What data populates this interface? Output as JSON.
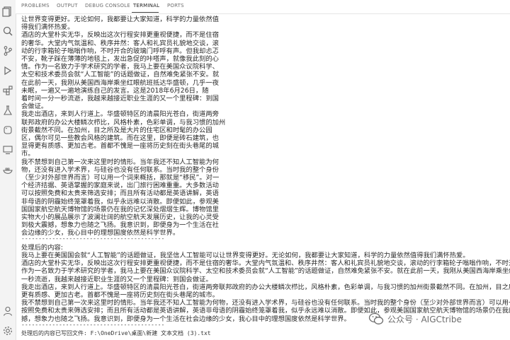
{
  "tabs": [
    {
      "label": "PROBLEMS"
    },
    {
      "label": "OUTPUT"
    },
    {
      "label": "DEBUG CONSOLE"
    },
    {
      "label": "TERMINAL"
    },
    {
      "label": "PORTS"
    }
  ],
  "narrow_lines": [
    "让世界变得更好。无论如何，我都要让大家知道，科学的力量依然值",
    "得我们满怀热爱。",
    "酒店的大堂朴实无华，反映出这次行程安排更重视便捷，而不是住宿",
    "的奢华。大堂内气氛温和、秩序井然：客人和礼宾员礼貌地交谈，滚",
    "动的行李箱轮子嗡嗡作响，不时开合的玻璃门呼呼有声。但我却忐忑",
    "不安，靴子踩在薄薄的地毯上，发出急促的咔嗒声，就像我此刻的心",
    "情。作为一名致力于学术研究的学者，我马上要在美国众议院科学、",
    "太空和技术委员会就“人工智能”的话题做证，自然难免紧张不安。就",
    "在此前一天，我刚从美国西海岸乘坐红眼航班抵达华盛顿，几乎一夜",
    "未眠，一遍又一遍地演练自己的发言。这是2018年6月26日，随",
    "着时间一分一秒流逝，我越来越接近职业生涯的又一个里程碑：到国",
    "会做证。",
    "我走出酒店，来到人行道上。华盛顿特区的清晨阳光苍白，街道两旁",
    "联邦政府的办公大楼鳞次栉比，风格朴素，色彩单调，与我习惯的加州",
    "街景截然不同。在加州，目之所及是大片的住宅区和时髦的办公园",
    "区，偶尔可见一些教会风格的建筑。而在这里，即便是砖石建筑，也",
    "显得更有质感、更加古老。首都不愧是一座将历史刻在街头巷尾的城",
    "市。",
    "我不禁想到自己第一次来这里时的情形。当年我还不知人工智能为何",
    "物，还没有进入学术界，与硅谷也没有任何联系。当时我的整个身份",
    "（至少对外部世界而言）可以用一个词来概括，那就是“移民”。对一",
    "个经济拮据、英语掌握的家庭来说，出门旅行困难重重。大多数活动",
    "可以按照免费和太贵来筛选安排；而且所有活动都是英语讲解，英语",
    "非母语的阴霾始终笼罩着我，似乎永远难以消散。即便如此，参观美",
    "国国家航空航天博物馆的场景仍在我的记忆深处熠熠生辉。博物馆里",
    "实物大小的展品展示了波澜壮阔的航空航天发展历史，让我的心灵受",
    "到极大震撼，想象力也随之飞扬。我意识到，即便身为一个生活在社",
    "会边缘的少女，我心目中的理想国度依然是科学世界。"
  ],
  "separator": "------------------------------------------",
  "processed_label": "处理后的内容:",
  "wide_lines": [
    "我马上要在美国国会就“人工智能”的话题做证，我坚信人工智能可以让世界变得更好。无论如何，我都要让大家知道，科学的力量依然值得我们满怀热爱。",
    "酒店的大堂朴实无华，反映出这次行程安排更重视便捷，而不是住宿的奢华。大堂内气氛温和、秩序井然：客人和礼宾员礼貌地交谈，滚动的行李箱轮子嗡嗡作响，不时开合的玻璃门呼呼有声。",
    "作为一名致力于学术研究的学者，我马上要在美国众议院科学、太空和技术委员会就“人工智能”的话题做证，自然难免紧张不安。就在此前一天，我刚从美国西海岸乘坐红眼航班抵达华盛顿，",
    "一秒流逝，我越来越接近职业生涯的又一个里程碑：到国会做证。",
    "我走出酒店，来到人行道上。华盛顿特区的清晨阳光苍白，街道两旁联邦政府的办公大楼鳞次栉比，风格朴素，色彩单调，与我习惯的加州街景截然不同。在加州，目之所及是大片的住宅区",
    "更有质感、更加古老。首都不愧是一座将历史刻在街头巷尾的城市。",
    "我不禁想到自己第一次来这里时的情形。当年我还不知人工智能为何物，还没有进入学术界，与硅谷也没有任何联系。当时我的整个身份（至少对外部世界而言）可以用一个词来概括，",
    "按照免费和太贵来筛选安排；而且所有活动都是英语讲解，英语非母语的阴霾始终笼罩着我，似乎永远难以消散。即便如此，参观美国国家航空航天博物馆的场景仍在我的记忆深处熠熠生辉。",
    "撼，想象力也随之飞扬。我意识到，即便身为一个生活在社会边缘的少女，我心目中的理想国度依然是科学世界。"
  ],
  "saved_message": "处理后的内容已写回文件: F:\\OneDrive\\桌面\\新建 文本文档 (3).txt",
  "watermark": {
    "text": "公众号 · AIGCtribe"
  },
  "colors": {
    "activity_bar": "#f3f3f3",
    "text": "#2a2a2a",
    "tab_inactive": "#6f6f6f"
  }
}
